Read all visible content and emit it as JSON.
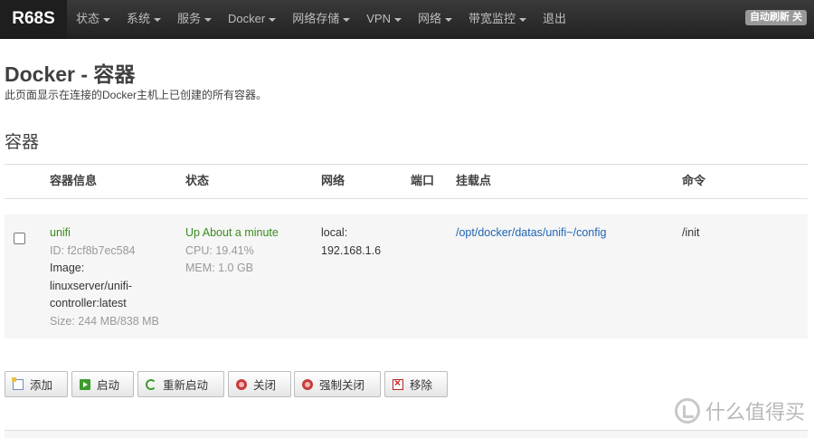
{
  "navbar": {
    "brand": "R68S",
    "menu": [
      {
        "label": "状态",
        "dropdown": true
      },
      {
        "label": "系统",
        "dropdown": true
      },
      {
        "label": "服务",
        "dropdown": true
      },
      {
        "label": "Docker",
        "dropdown": true
      },
      {
        "label": "网络存储",
        "dropdown": true
      },
      {
        "label": "VPN",
        "dropdown": true
      },
      {
        "label": "网络",
        "dropdown": true
      },
      {
        "label": "带宽监控",
        "dropdown": true
      },
      {
        "label": "退出",
        "dropdown": false
      }
    ],
    "refresh_badge": "自动刷新 关"
  },
  "page": {
    "title": "Docker - 容器",
    "description": "此页面显示在连接的Docker主机上已创建的所有容器。",
    "section_title": "容器"
  },
  "table": {
    "headers": {
      "info": "容器信息",
      "status": "状态",
      "network": "网络",
      "ports": "端口",
      "mounts": "挂载点",
      "command": "命令"
    },
    "rows": [
      {
        "name": "unifi",
        "id": "ID: f2cf8b7ec584",
        "image_label": "Image:",
        "image_line1": "linuxserver/unifi-",
        "image_line2": "controller:latest",
        "size": "Size: 244 MB/838 MB",
        "status": "Up About a minute",
        "cpu": "CPU: 19.41%",
        "mem": "MEM: 1.0 GB",
        "network_name": "local:",
        "network_ip": "192.168.1.6",
        "ports": "",
        "mount": "/opt/docker/datas/unifi~/config",
        "command": "/init"
      }
    ]
  },
  "actions": {
    "add": "添加",
    "start": "启动",
    "restart": "重新启动",
    "stop": "关闭",
    "kill": "强制关闭",
    "remove": "移除"
  },
  "watermark": "什么值得买"
}
